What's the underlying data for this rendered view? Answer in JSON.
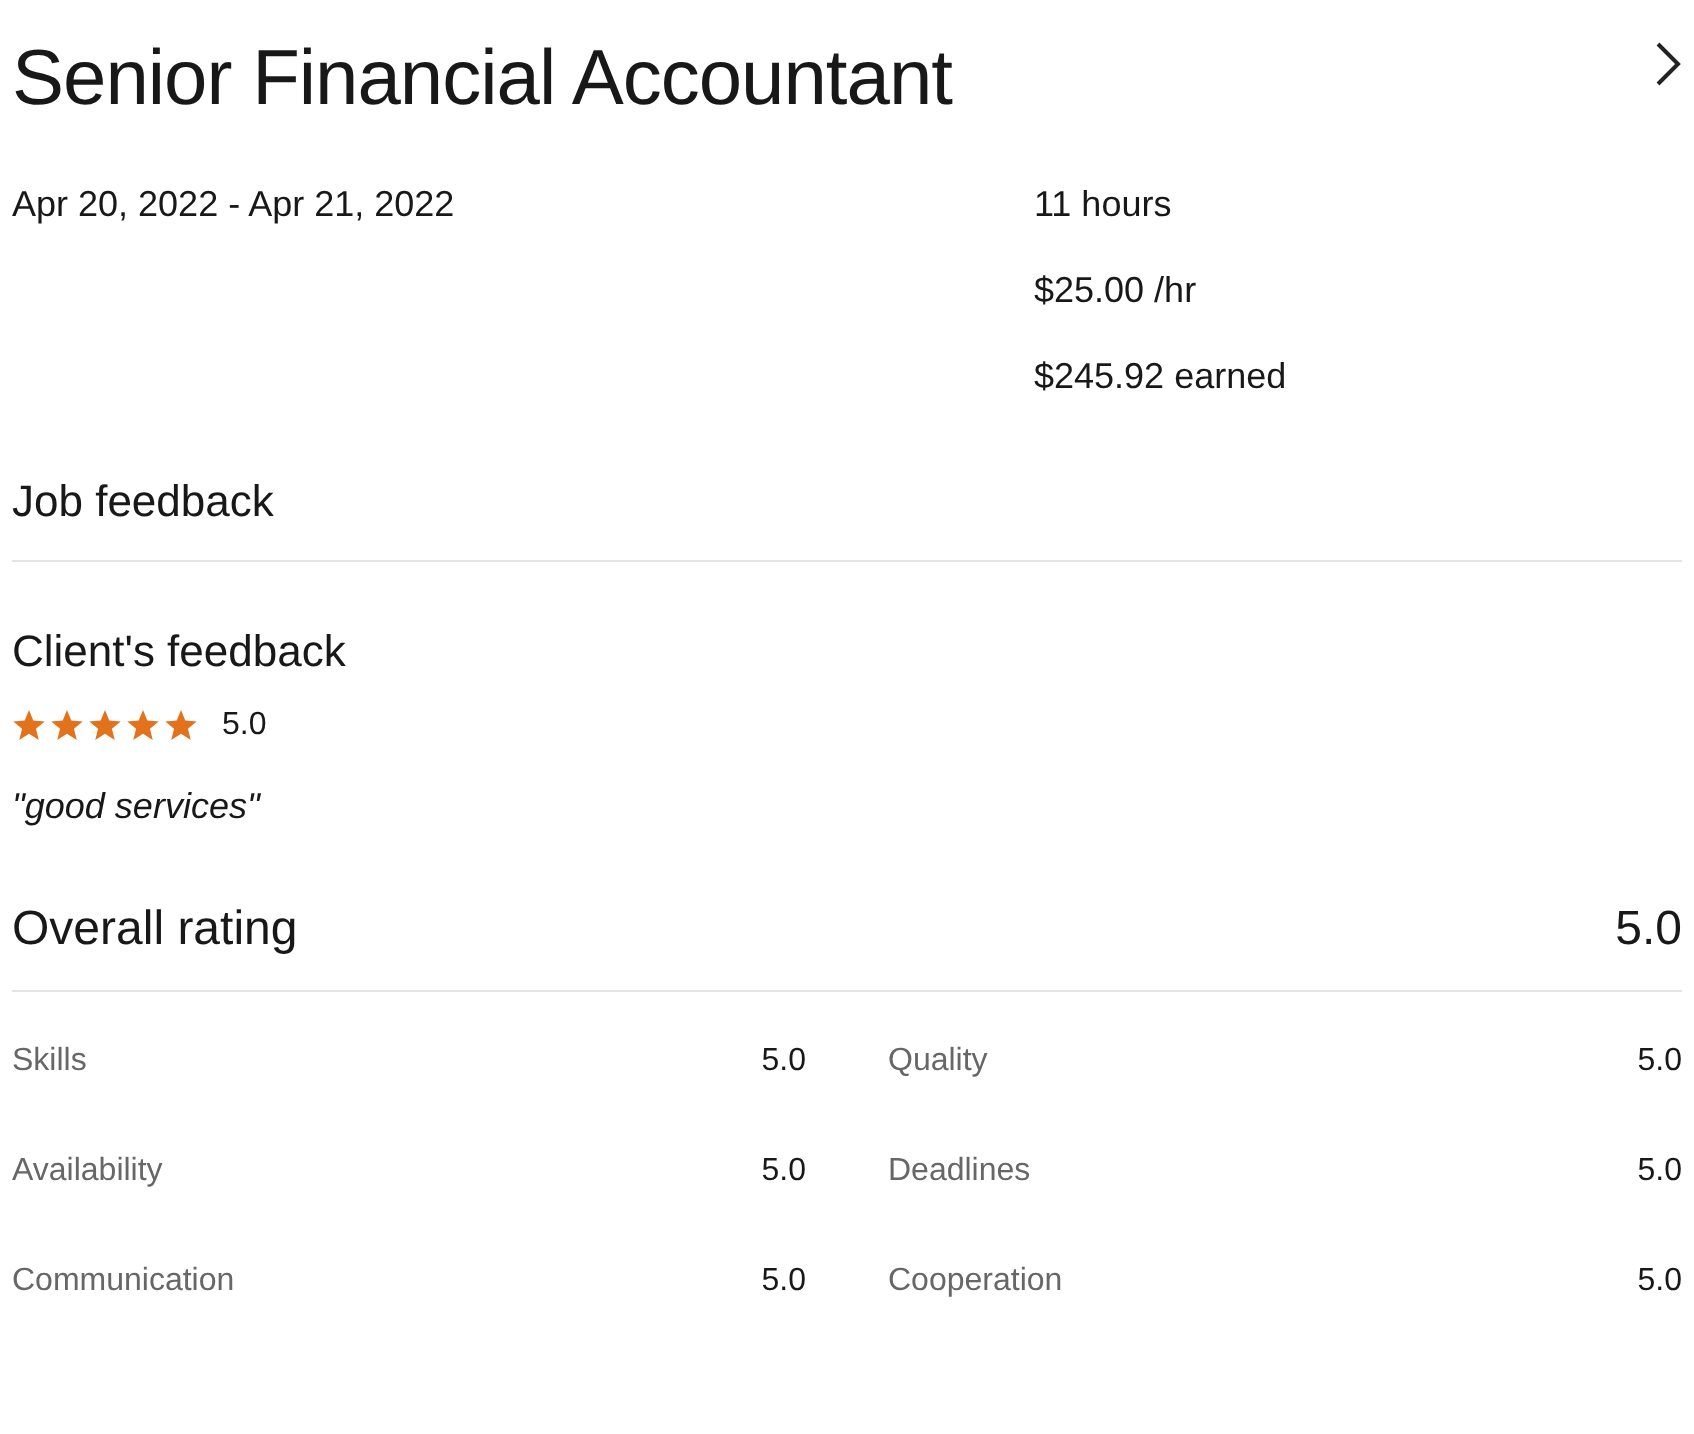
{
  "title": "Senior Financial Accountant",
  "dates": "Apr 20, 2022 - Apr 21, 2022",
  "summary": [
    "11 hours",
    "$25.00 /hr",
    "$245.92 earned"
  ],
  "job_feedback": {
    "heading": "Job feedback"
  },
  "client_feedback": {
    "heading": "Client's feedback",
    "stars": 5,
    "score": "5.0",
    "comment": "\"good services\""
  },
  "overall": {
    "label": "Overall rating",
    "score": "5.0"
  },
  "ratings": [
    {
      "label": "Skills",
      "score": "5.0"
    },
    {
      "label": "Quality",
      "score": "5.0"
    },
    {
      "label": "Availability",
      "score": "5.0"
    },
    {
      "label": "Deadlines",
      "score": "5.0"
    },
    {
      "label": "Communication",
      "score": "5.0"
    },
    {
      "label": "Cooperation",
      "score": "5.0"
    }
  ]
}
